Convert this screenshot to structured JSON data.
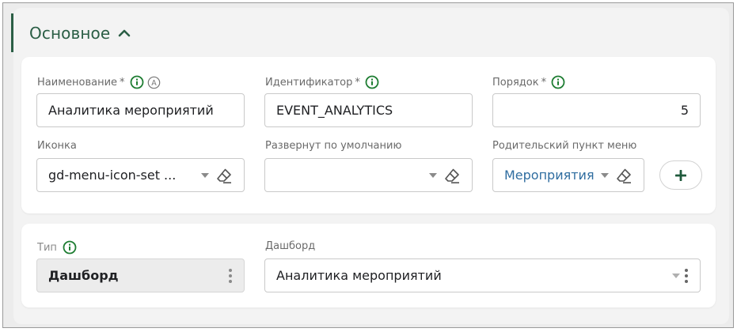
{
  "section": {
    "title": "Основное"
  },
  "fields": {
    "name": {
      "label": "Наименование",
      "required_mark": "*",
      "value": "Аналитика мероприятий"
    },
    "identifier": {
      "label": "Идентификатор",
      "required_mark": "*",
      "value": "EVENT_ANALYTICS"
    },
    "order": {
      "label": "Порядок",
      "required_mark": "*",
      "value": "5"
    },
    "icon": {
      "label": "Иконка",
      "value": "gd-menu-icon-set ..."
    },
    "expanded": {
      "label": "Развернут по умолчанию",
      "value": ""
    },
    "parent": {
      "label": "Родительский пункт меню",
      "value": "Мероприятия"
    },
    "type": {
      "label": "Тип",
      "value": "Дашборд"
    },
    "dashboard": {
      "label": "Дашборд",
      "value": "Аналитика мероприятий"
    }
  },
  "add_button": {
    "glyph": "+"
  },
  "auto_badge": {
    "glyph": "A"
  },
  "colors": {
    "accent": "#2b5e45",
    "info_green": "#1e7d32",
    "link": "#2f6da0",
    "field_border": "#c9c9c9",
    "disabled_bg": "#ececec"
  },
  "icons": [
    "chevron-up-icon",
    "info-icon",
    "auto-icon",
    "caret-down-icon",
    "eraser-icon",
    "plus-icon",
    "kebab-icon"
  ]
}
